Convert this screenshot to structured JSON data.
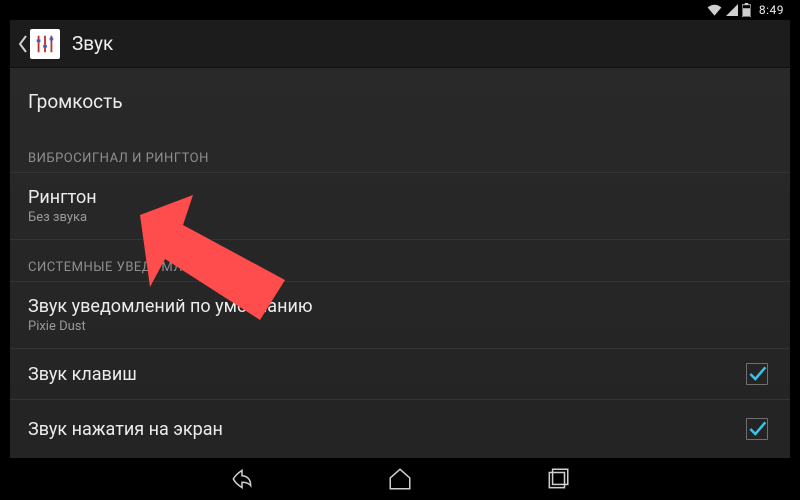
{
  "statusbar": {
    "time": "8:49"
  },
  "actionbar": {
    "title": "Звук"
  },
  "volume": {
    "label": "Громкость"
  },
  "sections": {
    "vibro": "ВИБРОСИГНАЛ И РИНГТОН",
    "system": "СИСТЕМНЫЕ УВЕДОМЛЕНИЯ"
  },
  "items": {
    "ringtone": {
      "title": "Рингтон",
      "subtitle": "Без звука"
    },
    "notification": {
      "title": "Звук уведомлений по умолчанию",
      "subtitle": "Pixie Dust"
    },
    "dialpad": {
      "title": "Звук клавиш",
      "checked": true
    },
    "touch": {
      "title": "Звук нажатия на экран",
      "checked": true
    }
  }
}
